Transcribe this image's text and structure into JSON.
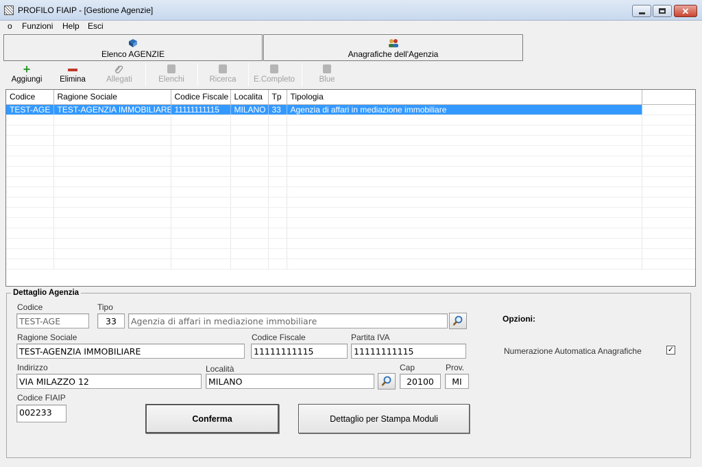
{
  "window": {
    "title": "PROFILO FIAIP - [Gestione Agenzie]",
    "controls": {
      "minimize": "–",
      "maximize": "□",
      "close": "✕"
    }
  },
  "menu": [
    "o",
    "Funzioni",
    "Help",
    "Esci"
  ],
  "module_tabs": [
    {
      "label": "Elenco AGENZIE",
      "icon": "book-icon"
    },
    {
      "label": "Anagrafiche dell'Agenzia",
      "icon": "people-icon"
    }
  ],
  "toolbar": {
    "aggiungi": "Aggiungi",
    "elimina": "Elimina",
    "allegati": "Allegati",
    "elenchi": "Elenchi",
    "ricerca": "Ricerca",
    "ecompleto": "E.Completo",
    "blue": "Blue"
  },
  "grid": {
    "columns": [
      "Codice",
      "Ragione Sociale",
      "Codice Fiscale",
      "Localita",
      "Tp",
      "Tipologia"
    ],
    "rows": [
      [
        "TEST-AGE",
        "TEST-AGENZIA IMMOBILIARE",
        "11111111115",
        "MILANO",
        "33",
        "Agenzia di affari in mediazione immobiliare"
      ]
    ],
    "selected_row": 0
  },
  "detail": {
    "group_title": "Dettaglio Agenzia",
    "codice_label": "Codice",
    "codice": "TEST-AGE",
    "tipo_label": "Tipo",
    "tipo": "33",
    "tipo_desc": "Agenzia di affari in mediazione immobiliare",
    "ragione_label": "Ragione Sociale",
    "ragione": "TEST-AGENZIA IMMOBILIARE",
    "cf_label": "Codice Fiscale",
    "cf": "11111111115",
    "piva_label": "Partita IVA",
    "piva": "11111111115",
    "indirizzo_label": "Indirizzo",
    "indirizzo": "VIA MILAZZO 12",
    "localita_label": "Località",
    "localita": "MILANO",
    "cap_label": "Cap",
    "cap": "20100",
    "prov_label": "Prov.",
    "prov": "MI",
    "fiaip_label": "Codice FIAIP",
    "fiaip": "002233"
  },
  "options": {
    "title": "Opzioni:",
    "numerazione_label": "Numerazione Automatica Anagrafiche",
    "numerazione_checked": true,
    "check_mark": "✓"
  },
  "buttons": {
    "conferma": "Conferma",
    "dettaglio": "Dettaglio per Stampa Moduli"
  }
}
